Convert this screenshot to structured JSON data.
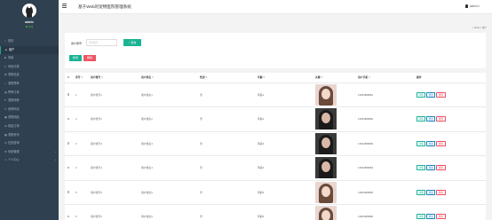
{
  "sidebar": {
    "user": {
      "name": "admin",
      "status": "在线"
    },
    "items": [
      {
        "label": "首页",
        "icon": "home-icon",
        "active": false,
        "arrow": false
      },
      {
        "label": "用户",
        "icon": "user-icon",
        "active": true,
        "arrow": false
      },
      {
        "label": "商家",
        "icon": "store-icon",
        "active": false,
        "arrow": false
      },
      {
        "label": "商品分类",
        "icon": "list-icon",
        "active": false,
        "arrow": false
      },
      {
        "label": "宠物信息",
        "icon": "paw-icon",
        "active": false,
        "arrow": false
      },
      {
        "label": "宠物寄养",
        "icon": "home-icon",
        "active": false,
        "arrow": false
      },
      {
        "label": "寄养订单",
        "icon": "order-icon",
        "active": false,
        "arrow": false
      },
      {
        "label": "宠物领养",
        "icon": "heart-icon",
        "active": false,
        "arrow": false
      },
      {
        "label": "领养申请",
        "icon": "form-icon",
        "active": false,
        "arrow": false
      },
      {
        "label": "宠物用品",
        "icon": "bag-icon",
        "active": false,
        "arrow": false
      },
      {
        "label": "用品订单",
        "icon": "cart-icon",
        "active": false,
        "arrow": false
      },
      {
        "label": "宠物资讯",
        "icon": "news-icon",
        "active": false,
        "arrow": false
      },
      {
        "label": "在线咨询",
        "icon": "chat-icon",
        "active": false,
        "arrow": false
      },
      {
        "label": "系统管理",
        "icon": "gear-icon",
        "active": false,
        "arrow": true
      },
      {
        "label": "个人中心",
        "icon": "person-icon",
        "active": false,
        "arrow": true
      }
    ]
  },
  "header": {
    "title": "基于Web的宠物医院管理系统",
    "user": "admin"
  },
  "breadcrumb": "Home / 用户",
  "search": {
    "label": "用户账号",
    "placeholder": "用户账号",
    "button": "查询"
  },
  "actions": {
    "add": "新增",
    "delete": "删除"
  },
  "table": {
    "headers": [
      "序号",
      "用户账号",
      "用户姓名",
      "性别",
      "年龄",
      "头像",
      "用户手机",
      "操作"
    ],
    "row_actions": {
      "view": "详情",
      "edit": "修改",
      "delete": "删除"
    },
    "rows": [
      {
        "no": "1",
        "account": "用户账号1",
        "name": "用户姓名1",
        "gender": "男",
        "age": "年龄1",
        "phone": "13823888881",
        "photo_style": "light"
      },
      {
        "no": "2",
        "account": "用户账号2",
        "name": "用户姓名2",
        "gender": "男",
        "age": "年龄2",
        "phone": "13823888882",
        "photo_style": "dark"
      },
      {
        "no": "3",
        "account": "用户账号3",
        "name": "用户姓名3",
        "gender": "男",
        "age": "年龄3",
        "phone": "13823888883",
        "photo_style": "dark"
      },
      {
        "no": "4",
        "account": "用户账号4",
        "name": "用户姓名4",
        "gender": "男",
        "age": "年龄4",
        "phone": "13823888884",
        "photo_style": "dark"
      },
      {
        "no": "5",
        "account": "用户账号5",
        "name": "用户姓名5",
        "gender": "男",
        "age": "年龄5",
        "phone": "13823888885",
        "photo_style": "light"
      },
      {
        "no": "6",
        "account": "用户账号6",
        "name": "用户姓名6",
        "gender": "男",
        "age": "年龄6",
        "phone": "13823888886",
        "photo_style": "light"
      }
    ]
  },
  "colors": {
    "sidebar_bg": "#2f4050",
    "primary": "#1ab394",
    "danger": "#ed5565",
    "info": "#1c84c6"
  }
}
